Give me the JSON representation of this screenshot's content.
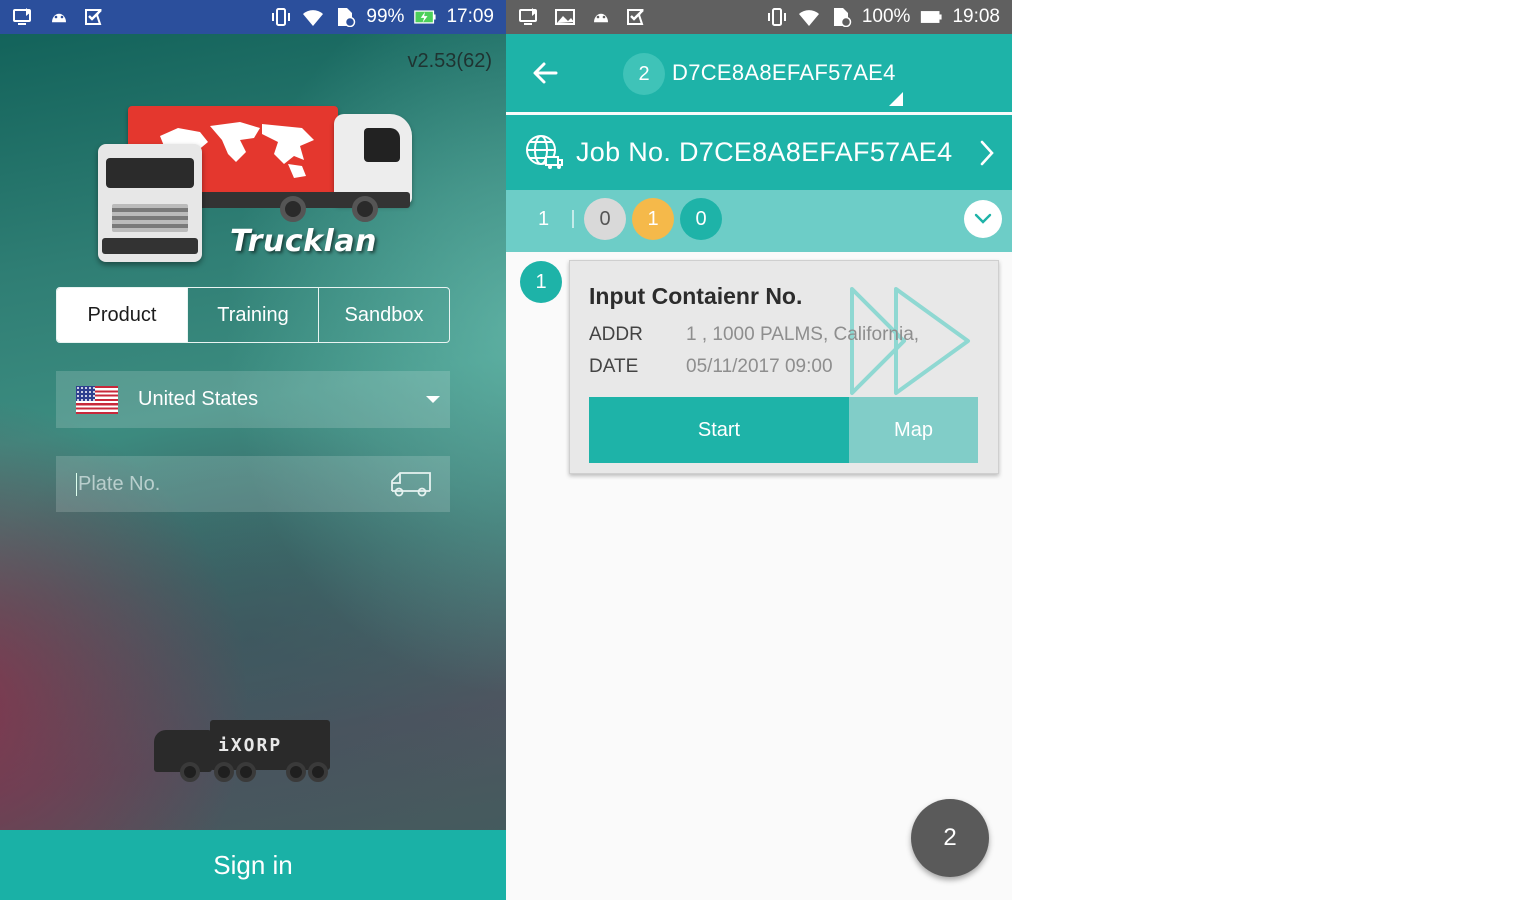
{
  "left_screen": {
    "statusbar": {
      "battery": "99%",
      "time": "17:09",
      "color": "#2b4f9c"
    },
    "version": "v2.53(62)",
    "brand": "Trucklan",
    "env_tabs": [
      {
        "label": "Product",
        "active": true
      },
      {
        "label": "Training",
        "active": false
      },
      {
        "label": "Sandbox",
        "active": false
      }
    ],
    "country": {
      "selected": "United States",
      "flag_icon": "us-flag-icon"
    },
    "plate": {
      "placeholder": "Plate No.",
      "value": "",
      "icon": "truck-icon"
    },
    "ixorp_logo": "iXORP",
    "signin_label": "Sign in",
    "accent": "#1ab1a6"
  },
  "right_screen": {
    "statusbar": {
      "battery": "100%",
      "time": "19:08",
      "color": "#606060"
    },
    "appbar": {
      "tab_count": "2",
      "tab_title": "D7CE8A8EFAF57AE4",
      "back_icon": "arrow-left-icon"
    },
    "job": {
      "label": "Job No. D7CE8A8EFAF57AE4",
      "icon": "globe-truck-icon"
    },
    "counts": {
      "total": "1",
      "grey": "0",
      "yellow": "1",
      "teal": "0"
    },
    "task": {
      "step": "1",
      "title": "Input Contaienr No.",
      "addr_label": "ADDR",
      "addr_value": "1  , 1000 PALMS, California,",
      "date_label": "DATE",
      "date_value": "05/11/2017 09:00",
      "start_label": "Start",
      "map_label": "Map"
    },
    "fab_label": "2",
    "colors": {
      "primary": "#1eb3a8",
      "light": "#6dcdc7",
      "yellow": "#f5b94a",
      "grey": "#d9d9d9"
    }
  }
}
